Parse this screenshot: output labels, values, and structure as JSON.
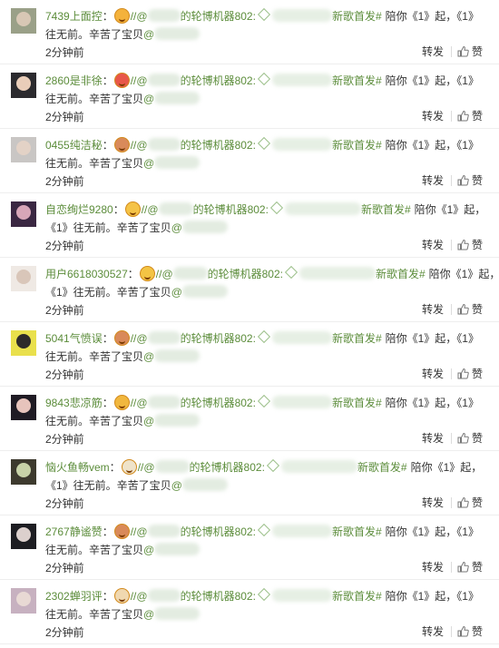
{
  "common": {
    "time": "2分钟前",
    "repost": "转发",
    "like": "赞",
    "slashes": "//",
    "at": "@",
    "robot_account": "的轮博机器802:",
    "hashtag": "新歌首发#",
    "hashtag_alt": "新歌首发#",
    "text_a": "陪你《1》起，《1》",
    "text_a_cont": "往无前。辛苦了宝贝",
    "text_b": "陪你《1》起，",
    "text_b_cont": "《1》往无前。辛苦了宝贝",
    "colon": "："
  },
  "comments": [
    {
      "user": "7439上面控",
      "emoji": "grin-emoji",
      "emoji_color": "#f4b23c",
      "avatar_hair": "#9aa088",
      "avatar_face": "#d8c7b5",
      "layout": "a",
      "robot_variant": "的轮博机器802:"
    },
    {
      "user": "2860是非徐",
      "emoji": "heart-eyes-emoji",
      "emoji_color": "#e8574a",
      "avatar_hair": "#2b2a2e",
      "avatar_face": "#e9cdb9",
      "layout": "a",
      "robot_variant": "的轮博机器802:"
    },
    {
      "user": "0455纯洁秘",
      "emoji": "monkey-emoji",
      "emoji_color": "#d98a5a",
      "avatar_hair": "#c9c6c4",
      "avatar_face": "#e3d2c6",
      "layout": "a",
      "robot_variant": "的轮博机器802:"
    },
    {
      "user": "自恋绚烂9280",
      "emoji": "tongue-emoji",
      "emoji_color": "#f5c347",
      "avatar_hair": "#3a2742",
      "avatar_face": "#d7a6b8",
      "layout": "b",
      "robot_variant": "的轮博机器802:"
    },
    {
      "user": "用户6618030527",
      "emoji": "smile-emoji",
      "emoji_color": "#f3c444",
      "avatar_hair": "#efe9e4",
      "avatar_face": "#d9c6b9",
      "layout": "b",
      "robot_variant": "的轮博机器802:"
    },
    {
      "user": "5041气愤误",
      "emoji": "monkey-emoji",
      "emoji_color": "#d98a5a",
      "avatar_hair": "#e9e04c",
      "avatar_face": "#2d2a2a",
      "layout": "a",
      "robot_variant": "的轮博机器802:"
    },
    {
      "user": "9843悲凉筋",
      "emoji": "laugh-emoji",
      "emoji_color": "#f1b73e",
      "avatar_hair": "#1f1b24",
      "avatar_face": "#e7c4bc",
      "layout": "a",
      "robot_variant": "的轮博机器802:"
    },
    {
      "user": "恼火鱼畅vem",
      "emoji": "glasses-emoji",
      "emoji_color": "#efe3c9",
      "avatar_hair": "#3d3a2e",
      "avatar_face": "#c8d3a8",
      "layout": "b",
      "robot_variant": "的轮博机器802:"
    },
    {
      "user": "2767静谧赞",
      "emoji": "monkey-emoji",
      "emoji_color": "#d98a5a",
      "avatar_hair": "#1d1d22",
      "avatar_face": "#dcd0cd",
      "layout": "a",
      "robot_variant": "的轮博机器802:"
    },
    {
      "user": "2302蝉羽评",
      "emoji": "cat-emoji",
      "emoji_color": "#f0d8b0",
      "avatar_hair": "#c7b1c0",
      "avatar_face": "#e8d9d4",
      "layout": "a",
      "robot_variant": "的轮博机器802:"
    }
  ]
}
